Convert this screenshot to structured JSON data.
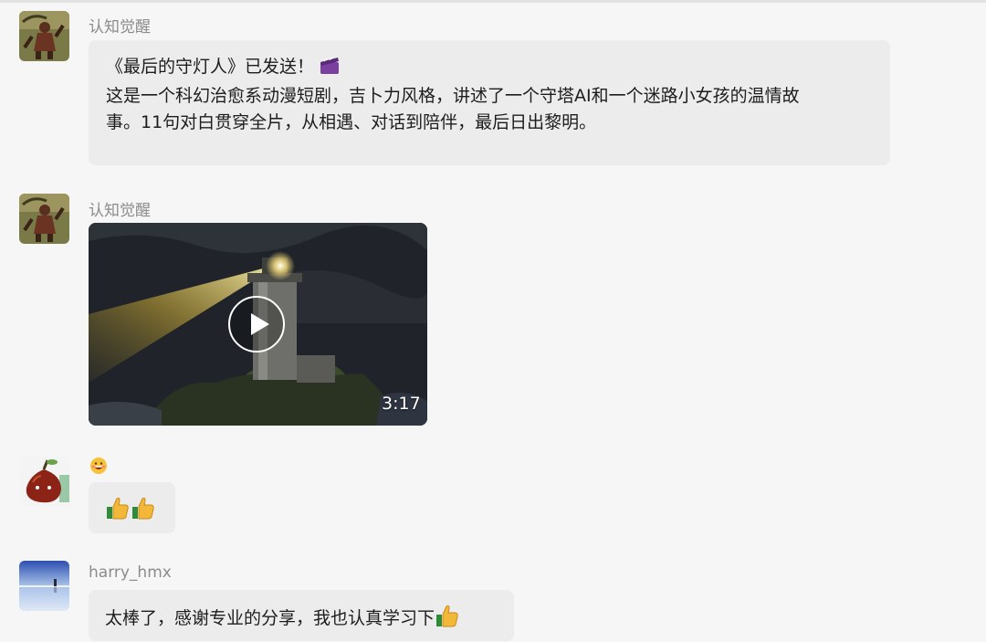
{
  "colors": {
    "background": "#f6f6f6",
    "bubble": "#ececec",
    "sender_name": "#8c8c8c"
  },
  "messages": [
    {
      "sender": "认知觉醒",
      "avatar_icon": "warrior-avatar-icon",
      "lines": [
        "《最后的守灯人》已发送！",
        "",
        "这是一个科幻治愈系动漫短剧，吉卜力风格，讲述了一个守塔AI和一个迷路小女孩的温情故",
        "事。11句对白贯穿全片，从相遇、对话到陪伴，最后日出黎明。"
      ],
      "trailing_icon": "clapperboard-icon"
    },
    {
      "sender": "认知觉醒",
      "avatar_icon": "warrior-avatar-icon",
      "video": {
        "thumbnail": "lighthouse-night-scene",
        "duration": "3:17"
      }
    },
    {
      "sender": "",
      "avatar_icon": "pear-avatar-icon",
      "reaction_icon": "grinning-face-icon",
      "bubble_icons": [
        "thumbs-up-icon",
        "thumbs-up-icon"
      ]
    },
    {
      "sender": "harry_hmx",
      "avatar_icon": "salt-flat-avatar-icon",
      "text": "太棒了，感谢专业的分享，我也认真学习下",
      "trailing_icon": "thumbs-up-icon"
    }
  ]
}
